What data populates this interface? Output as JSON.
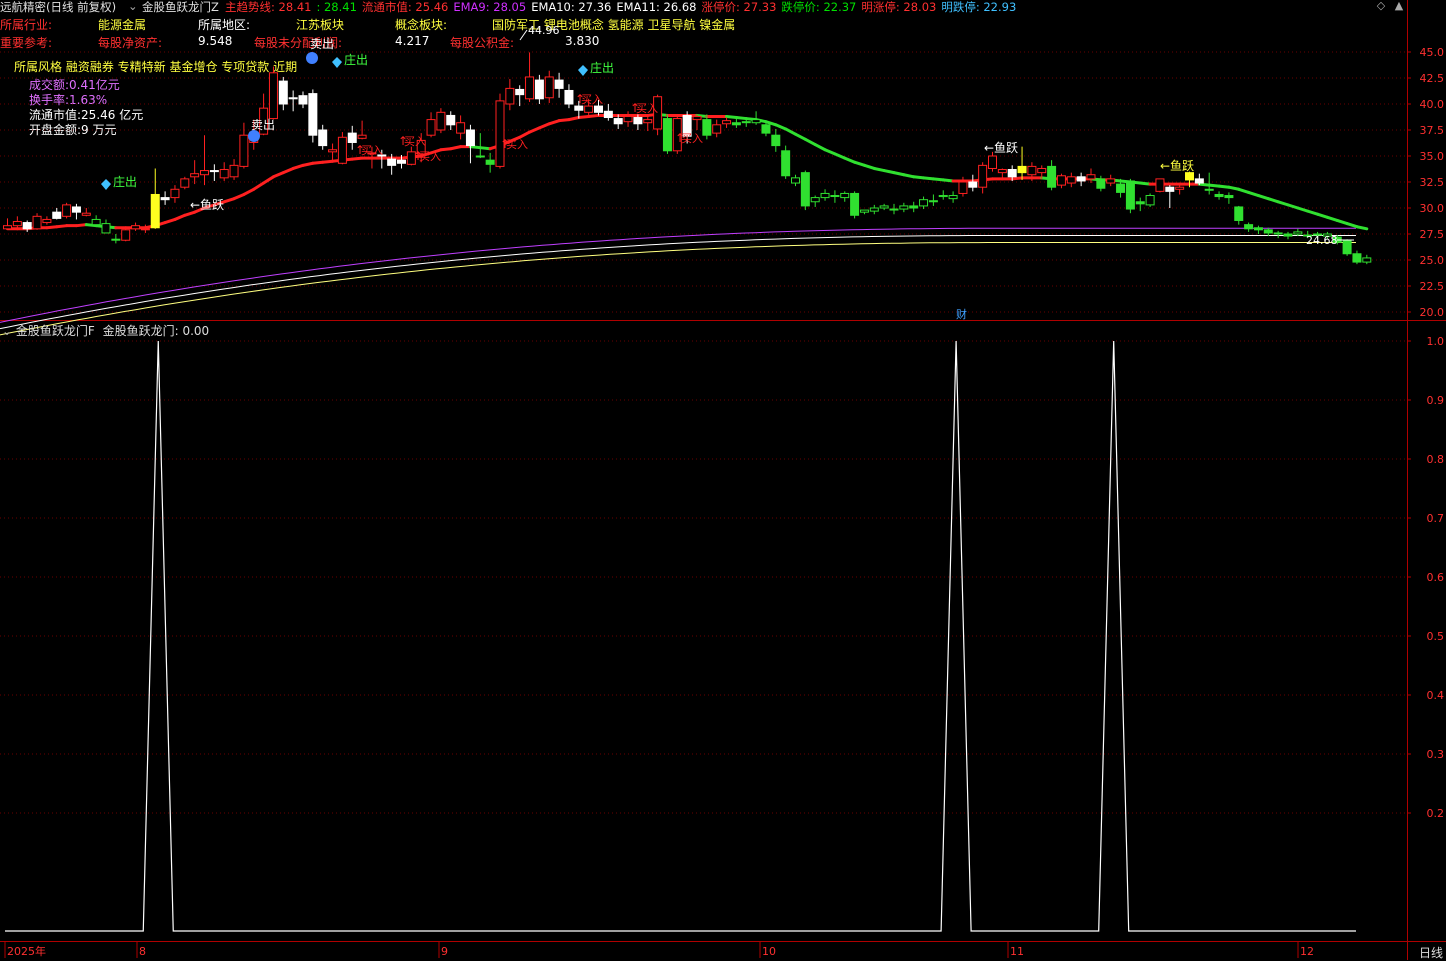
{
  "header": {
    "app_title": "远航精密(日线 前复权)",
    "indicator_title": "金股鱼跃龙门Z",
    "items": [
      {
        "label": "主趋势线:",
        "value": "28.41",
        "color": "#ff3030"
      },
      {
        "label": ":",
        "value": "28.41",
        "color": "#00e000"
      },
      {
        "label": "流通市值:",
        "value": "25.46",
        "color": "#ff3030"
      },
      {
        "label": "EMA9:",
        "value": "28.05",
        "color": "#d030ff"
      },
      {
        "label": "EMA10:",
        "value": "27.36",
        "color": "#ffffff"
      },
      {
        "label": "EMA11:",
        "value": "26.68",
        "color": "#ffffff"
      },
      {
        "label": "涨停价:",
        "value": "27.33",
        "color": "#ff3030"
      },
      {
        "label": "跌停价:",
        "value": "22.37",
        "color": "#00e000"
      },
      {
        "label": "明涨停:",
        "value": "28.03",
        "color": "#ff3030"
      },
      {
        "label": "明跌停:",
        "value": "22.93",
        "color": "#40c0ff"
      }
    ]
  },
  "info_panel": {
    "row1": [
      {
        "text": "所属行业:",
        "color": "#ff3030"
      },
      {
        "text": "能源金属",
        "color": "#ffff40"
      },
      {
        "text": "所属地区:",
        "color": "#ffffff"
      },
      {
        "text": "江苏板块",
        "color": "#ffff40"
      },
      {
        "text": "概念板块:",
        "color": "#ffff40"
      },
      {
        "text": "国防军工 锂电池概念 氢能源 卫星导航 镍金属",
        "color": "#ffff40"
      }
    ],
    "row2": [
      {
        "text": "重要参考:",
        "color": "#ff3030"
      },
      {
        "text": "每股净资产:",
        "color": "#ff3030"
      },
      {
        "text": "9.548",
        "color": "#ffffff"
      },
      {
        "text": "每股未分配利润:",
        "color": "#ff3030"
      },
      {
        "text": "4.217",
        "color": "#ffffff"
      },
      {
        "text": "每股公积金:",
        "color": "#ff3030"
      },
      {
        "text": "3.830",
        "color": "#ffffff"
      }
    ],
    "style_line": "所属风格 融资融券 专精特新 基金增仓 专项贷款 近期",
    "lines": [
      {
        "text": "成交额:0.41亿元",
        "color": "#e070ff"
      },
      {
        "text": "换手率:1.63%",
        "color": "#e070ff"
      },
      {
        "text": "流通市值:25.46 亿元",
        "color": "#ffffff"
      },
      {
        "text": "开盘金额:9 万元",
        "color": "#ffffff"
      }
    ]
  },
  "sub_panel": {
    "title": "金股鱼跃龙门F",
    "value_label": "金股鱼跃龙门: 0.00"
  },
  "x_axis": {
    "labels": [
      "2025年",
      "8",
      "9",
      "10",
      "11",
      "12"
    ],
    "period": "日线"
  },
  "annotations": {
    "high_label": "44.96",
    "last_price": "24.68",
    "fin_mark": "财",
    "buy": "买入",
    "sell": "卖出",
    "zhuang_out": "庄出",
    "fish_jump": "鱼跃"
  },
  "chart_data": [
    {
      "type": "candlestick",
      "title": "远航精密(日线 前复权)",
      "y_ticks": [
        "45.0",
        "42.5",
        "40.0",
        "37.5",
        "35.0",
        "32.5",
        "30.0",
        "27.5",
        "25.0",
        "22.5",
        "20.0"
      ],
      "ylim": [
        17.2,
        47
      ],
      "candles": [
        [
          28.0,
          28.3,
          29.0,
          27.9
        ],
        [
          28.3,
          28.7,
          29.2,
          27.9
        ],
        [
          28.6,
          28.0,
          28.8,
          27.7
        ],
        [
          28.0,
          29.2,
          29.5,
          27.9
        ],
        [
          28.6,
          28.9,
          29.2,
          28.4
        ],
        [
          29.6,
          29.0,
          30.0,
          28.9
        ],
        [
          29.2,
          30.3,
          30.5,
          29.0
        ],
        [
          30.1,
          29.6,
          30.4,
          28.9
        ],
        [
          29.3,
          29.5,
          30.0,
          29.2
        ],
        [
          28.4,
          28.9,
          29.3,
          28.2
        ],
        [
          27.6,
          28.5,
          28.9,
          27.6
        ],
        [
          27.0,
          27.0,
          27.5,
          26.6
        ],
        [
          26.9,
          27.9,
          28.0,
          26.8
        ],
        [
          28.0,
          28.3,
          28.6,
          27.8
        ],
        [
          28.0,
          28.0,
          28.4,
          27.6
        ],
        [
          28.1,
          31.3,
          33.8,
          28.0
        ],
        [
          31.0,
          30.8,
          31.6,
          30.3
        ],
        [
          31.0,
          31.8,
          32.2,
          30.5
        ],
        [
          32.0,
          32.8,
          33.0,
          31.8
        ],
        [
          33.0,
          33.3,
          34.6,
          32.3
        ],
        [
          33.2,
          33.6,
          37.0,
          32.2
        ],
        [
          33.6,
          33.5,
          34.2,
          32.6
        ],
        [
          32.9,
          33.7,
          34.4,
          32.6
        ],
        [
          33.0,
          34.1,
          34.7,
          32.7
        ],
        [
          34.0,
          37.0,
          38.2,
          33.8
        ],
        [
          36.3,
          37.3,
          38.5,
          35.6
        ],
        [
          37.1,
          39.6,
          41.0,
          37.0
        ],
        [
          38.6,
          43.0,
          43.6,
          38.5
        ],
        [
          42.2,
          40.0,
          42.6,
          39.4
        ],
        [
          40.6,
          40.5,
          41.3,
          39.3
        ],
        [
          40.8,
          40.0,
          41.2,
          39.6
        ],
        [
          41.0,
          37.0,
          41.4,
          36.3
        ],
        [
          37.5,
          36.0,
          38.0,
          35.6
        ],
        [
          35.4,
          35.6,
          36.2,
          34.6
        ],
        [
          34.3,
          36.8,
          37.3,
          34.2
        ],
        [
          37.2,
          36.3,
          37.9,
          35.6
        ],
        [
          36.7,
          37.0,
          38.4,
          36.6
        ],
        [
          35.2,
          35.3,
          35.9,
          33.8
        ],
        [
          35.1,
          35.0,
          35.6,
          33.8
        ],
        [
          34.7,
          34.1,
          35.2,
          33.2
        ],
        [
          34.6,
          34.3,
          35.1,
          33.8
        ],
        [
          34.2,
          35.4,
          35.9,
          34.1
        ],
        [
          35.2,
          36.5,
          37.2,
          34.4
        ],
        [
          37.0,
          38.5,
          39.2,
          36.8
        ],
        [
          37.5,
          39.2,
          39.6,
          37.2
        ],
        [
          38.9,
          38.0,
          39.3,
          37.5
        ],
        [
          37.2,
          38.2,
          38.9,
          36.6
        ],
        [
          37.5,
          36.0,
          38.0,
          34.3
        ],
        [
          35.0,
          35.0,
          37.2,
          34.8
        ],
        [
          34.6,
          34.2,
          35.3,
          33.4
        ],
        [
          34.0,
          40.3,
          41.0,
          33.8
        ],
        [
          40.0,
          41.5,
          42.4,
          39.4
        ],
        [
          41.4,
          40.9,
          41.8,
          39.8
        ],
        [
          40.5,
          42.6,
          44.96,
          40.2
        ],
        [
          42.3,
          40.5,
          42.8,
          40.0
        ],
        [
          40.6,
          42.6,
          43.2,
          40.1
        ],
        [
          42.3,
          41.5,
          43.0,
          40.6
        ],
        [
          41.3,
          40.0,
          41.9,
          39.6
        ],
        [
          39.8,
          39.4,
          40.3,
          38.6
        ],
        [
          39.2,
          39.8,
          40.5,
          38.7
        ],
        [
          39.8,
          39.2,
          40.4,
          38.9
        ],
        [
          39.3,
          38.7,
          40.0,
          38.4
        ],
        [
          38.6,
          38.1,
          39.0,
          37.6
        ],
        [
          38.3,
          38.8,
          39.3,
          37.8
        ],
        [
          38.7,
          38.1,
          39.0,
          37.5
        ],
        [
          38.2,
          38.5,
          38.8,
          37.4
        ],
        [
          37.6,
          40.7,
          40.9,
          37.0
        ],
        [
          38.6,
          35.5,
          39.0,
          35.2
        ],
        [
          35.5,
          38.6,
          39.0,
          35.2
        ],
        [
          38.9,
          36.9,
          39.3,
          36.2
        ],
        [
          38.5,
          38.8,
          39.0,
          37.5
        ],
        [
          38.5,
          37.0,
          39.0,
          36.6
        ],
        [
          37.2,
          38.0,
          38.5,
          36.8
        ],
        [
          38.1,
          38.4,
          38.7,
          37.7
        ],
        [
          38.2,
          38.0,
          38.6,
          37.7
        ],
        [
          38.3,
          38.3,
          38.6,
          37.8
        ],
        [
          38.2,
          38.5,
          39.3,
          38.0
        ],
        [
          38.0,
          37.2,
          38.3,
          36.9
        ],
        [
          37.0,
          36.0,
          37.6,
          35.4
        ],
        [
          35.5,
          33.1,
          36.0,
          32.8
        ],
        [
          32.4,
          32.9,
          33.2,
          32.1
        ],
        [
          33.4,
          30.2,
          33.6,
          29.8
        ],
        [
          30.6,
          31.0,
          31.2,
          30.1
        ],
        [
          31.0,
          31.4,
          31.8,
          30.7
        ],
        [
          31.2,
          31.2,
          31.7,
          30.5
        ],
        [
          31.0,
          31.4,
          31.6,
          30.6
        ],
        [
          31.4,
          29.3,
          31.6,
          29.0
        ],
        [
          29.6,
          29.8,
          29.8,
          29.4
        ],
        [
          29.7,
          30.0,
          30.3,
          29.4
        ],
        [
          30.0,
          30.2,
          30.4,
          29.8
        ],
        [
          29.9,
          29.9,
          30.4,
          29.4
        ],
        [
          29.9,
          30.2,
          30.5,
          29.6
        ],
        [
          30.2,
          30.0,
          30.6,
          29.6
        ],
        [
          30.2,
          30.8,
          31.1,
          29.9
        ],
        [
          30.7,
          30.6,
          31.3,
          30.2
        ],
        [
          31.1,
          31.2,
          31.7,
          30.8
        ],
        [
          30.9,
          31.2,
          31.6,
          30.5
        ],
        [
          31.4,
          32.5,
          33.0,
          31.1
        ],
        [
          32.5,
          32.0,
          33.2,
          31.6
        ],
        [
          32.0,
          34.1,
          34.4,
          31.4
        ],
        [
          33.8,
          35.0,
          35.4,
          33.5
        ],
        [
          33.4,
          33.7,
          33.8,
          32.7
        ],
        [
          33.7,
          33.0,
          34.1,
          32.6
        ],
        [
          33.4,
          34.0,
          35.9,
          32.7
        ],
        [
          33.2,
          34.0,
          34.4,
          32.6
        ],
        [
          33.4,
          33.8,
          34.1,
          32.8
        ],
        [
          34.0,
          32.0,
          34.6,
          31.7
        ],
        [
          32.2,
          33.1,
          33.3,
          31.9
        ],
        [
          32.4,
          33.0,
          33.4,
          32.0
        ],
        [
          33.0,
          32.6,
          33.4,
          32.1
        ],
        [
          32.8,
          33.2,
          33.8,
          32.4
        ],
        [
          32.8,
          31.9,
          33.1,
          31.6
        ],
        [
          32.4,
          32.8,
          33.2,
          32.1
        ],
        [
          32.3,
          31.5,
          32.8,
          31.0
        ],
        [
          32.6,
          29.9,
          32.8,
          29.5
        ],
        [
          30.6,
          30.4,
          31.0,
          29.7
        ],
        [
          30.3,
          31.2,
          31.4,
          30.1
        ],
        [
          31.6,
          32.8,
          32.8,
          31.5
        ],
        [
          32.0,
          31.6,
          32.2,
          30.0
        ],
        [
          31.8,
          32.0,
          32.2,
          31.3
        ],
        [
          32.7,
          33.4,
          33.5,
          32.0
        ],
        [
          32.8,
          32.4,
          33.3,
          32.2
        ],
        [
          31.8,
          31.8,
          33.4,
          31.3
        ],
        [
          31.3,
          31.1,
          31.6,
          30.8
        ],
        [
          31.2,
          31.0,
          31.5,
          30.4
        ],
        [
          30.1,
          28.8,
          30.2,
          28.4
        ],
        [
          28.4,
          28.0,
          28.6,
          27.7
        ],
        [
          28.1,
          27.9,
          28.3,
          27.5
        ],
        [
          27.9,
          27.6,
          28.1,
          27.3
        ],
        [
          27.6,
          27.6,
          27.8,
          27.1
        ],
        [
          27.5,
          27.3,
          27.7,
          27.0
        ],
        [
          27.5,
          27.7,
          28.0,
          27.3
        ],
        [
          27.4,
          27.4,
          27.8,
          27.1
        ],
        [
          27.5,
          27.4,
          27.7,
          27.1
        ],
        [
          27.3,
          27.5,
          27.7,
          27.0
        ],
        [
          27.2,
          26.7,
          27.4,
          26.5
        ],
        [
          26.9,
          25.6,
          27.0,
          25.4
        ],
        [
          25.6,
          24.8,
          25.9,
          24.6
        ],
        [
          24.8,
          25.2,
          25.5,
          24.6
        ]
      ],
      "main_trend_line": [
        28.0,
        28.0,
        28.0,
        28.1,
        28.1,
        28.2,
        28.3,
        28.3,
        28.4,
        28.3,
        28.2,
        28.1,
        28.1,
        28.1,
        28.1,
        28.3,
        28.6,
        28.9,
        29.3,
        29.6,
        30.0,
        30.3,
        30.6,
        30.9,
        31.3,
        31.8,
        32.4,
        33.0,
        33.4,
        33.8,
        34.1,
        34.3,
        34.4,
        34.5,
        34.6,
        34.7,
        34.8,
        34.8,
        34.8,
        34.8,
        34.8,
        34.9,
        35.0,
        35.3,
        35.6,
        35.7,
        35.9,
        35.9,
        35.8,
        35.7,
        36.0,
        36.4,
        36.8,
        37.3,
        37.7,
        38.1,
        38.4,
        38.5,
        38.7,
        38.8,
        38.9,
        38.9,
        38.9,
        38.9,
        38.9,
        38.9,
        39.0,
        38.9,
        38.9,
        38.9,
        38.9,
        38.8,
        38.8,
        38.8,
        38.7,
        38.6,
        38.5,
        38.3,
        38.0,
        37.6,
        37.1,
        36.6,
        36.1,
        35.6,
        35.2,
        34.8,
        34.4,
        34.1,
        33.8,
        33.6,
        33.4,
        33.2,
        33.0,
        32.9,
        32.8,
        32.7,
        32.6,
        32.6,
        32.6,
        32.7,
        32.8,
        32.8,
        32.8,
        32.9,
        32.9,
        32.9,
        32.8,
        32.8,
        32.8,
        32.8,
        32.8,
        32.7,
        32.7,
        32.6,
        32.5,
        32.4,
        32.3,
        32.3,
        32.3,
        32.3,
        32.3,
        32.3,
        32.2,
        32.1,
        32.0,
        31.8,
        31.5,
        31.2,
        30.9,
        30.6,
        30.3,
        30.0,
        29.7,
        29.4,
        29.1,
        28.8,
        28.5,
        28.2,
        28.0
      ],
      "ema_lines": [
        {
          "name": "EMA9",
          "color": "#c040ff",
          "start": 19.0,
          "end": 28.05
        },
        {
          "name": "EMA10",
          "color": "#ffffff",
          "start": 18.4,
          "end": 27.36
        },
        {
          "name": "EMA11",
          "color": "#ffff80",
          "start": 17.8,
          "end": 26.68
        }
      ]
    },
    {
      "type": "line",
      "title": "金股鱼跃龙门F",
      "y_ticks": [
        "1.0",
        "0.9",
        "0.8",
        "0.7",
        "0.6",
        "0.5",
        "0.4",
        "0.3",
        "0.2"
      ],
      "ylim": [
        0,
        1
      ],
      "spikes_at": [
        15,
        96,
        112
      ],
      "values_note": "0 everywhere except 1.0 at spikes"
    }
  ]
}
